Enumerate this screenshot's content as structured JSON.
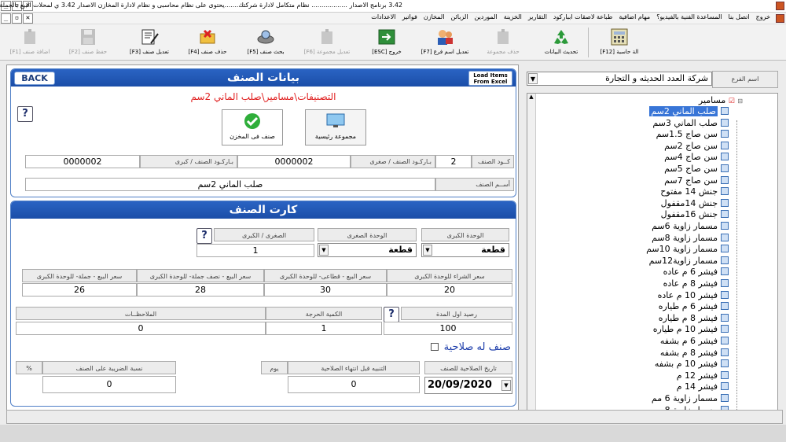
{
  "window": {
    "title": "3.42 برنامج الاصدار .................. نظام متكامل لادارة شركتك.......يحتوى على نظام محاسبى و نظام لادارة المخازن الاصدار 3.42 ي لمحلات البيع بالجملة و التجارة"
  },
  "menu": [
    "الاعدادات",
    "فواتير",
    "المخازن",
    "الزبائن",
    "الموردين",
    "الخزينة",
    "التقارير",
    "طباعة لاصقات ابباركود",
    "مهام اضافية",
    "المساعدة الفنية بالفيديو؟",
    "اتصل بنا",
    "خروج"
  ],
  "toolbar": {
    "calc": "الة حاسبة [F12]",
    "refresh": "تحديث البيانات",
    "delete_group": "حذف مجموعة",
    "rename_branch": "تعديل اسم فرع [F7]",
    "exit": "خروج [ESC]",
    "edit_group": "تعديل مجموعة [F6]",
    "search_item": "بحث صنف [F5]",
    "delete_item": "حذف صنف [F4]",
    "edit_item": "تعديل صنف [F3]",
    "save_item": "حفظ صنف [F2]",
    "add_item": "اضافة صنف [F1]"
  },
  "item_panel": {
    "title": "بيانات الصنف",
    "back": "BACK",
    "load_excel_l1": "Load Items",
    "load_excel_l2": "From Excel",
    "path": "التصنيفات\\مسامير\\صلب الماني 2سم",
    "help": "?",
    "main_group": "مجموعة رئيسية",
    "stock_item": "صنف فى المخزن",
    "code_label": "كــود الصنف",
    "code_value": "2",
    "barcode_small_label": "بـاركـود الصنف / صغرى",
    "barcode_small_value": "0000002",
    "barcode_big_label": "بـاركـود الصنف / كبرى",
    "barcode_big_value": "0000002",
    "name_label": "أســم الصنف",
    "name_value": "صلب الماني 2سم"
  },
  "card_panel": {
    "title": "كارت الصنف",
    "big_unit_label": "الوحدة الكبرى",
    "big_unit_value": "قطعة",
    "small_unit_label": "الوحدة الصغرى",
    "small_unit_value": "قطعة",
    "ratio_label": "الصغرى / الكبرى",
    "ratio_value": "1",
    "help": "?",
    "price_cols": [
      "سعر الشراء للوحدة الكبرى",
      "سعر البيع - قطاعى- للوحدة الكبرى",
      "سعر البيع - نصف جملة- للوحدة الكبرى",
      "سعر البيع - جملة- للوحدة الكبرى"
    ],
    "price_vals": [
      "20",
      "30",
      "28",
      "26"
    ],
    "opening_label": "رصيد اول المدة",
    "opening_value": "100",
    "critical_label": "الكمية الحرجة",
    "critical_value": "1",
    "notes_label": "الملاحظــات",
    "notes_value": "0",
    "expiry_checkbox": "صنف له صلاحية",
    "expiry_date_label": "تاريخ الصلاحية للصنف",
    "expiry_date_value": "20/09/2020",
    "alert_label": "التنبيه قبل انتهاء الصلاحية",
    "alert_value": "0",
    "alert_unit": "يوم",
    "tax_label": "نسبة الضريبة على الصنف",
    "tax_value": "0",
    "tax_unit": "%"
  },
  "branch": {
    "label": "اسم الفرع",
    "value": "شركة العدد الحديثه و التجارة"
  },
  "tree": {
    "root": "مسامير",
    "items": [
      "صلب الماني 2سم",
      "صلب الماني 3سم",
      "سن صاج 1.5سم",
      "سن صاج 2سم",
      "سن صاج 4سم",
      "سن صاج 5سم",
      "سن صاج 7سم",
      "جنش 14 مفتوح",
      "جنش 14مقفول",
      "جنش 16مقفول",
      "مسمار زاوية 6سم",
      "مسمار زاوية 8سم",
      "مسمار زاوية 10سم",
      "مسمار زاوية12سم",
      "فيشر 6 م عاده",
      "فيشر 8 م عاده",
      "فيشر 10 م عاده",
      "فيشر 6 م طياره",
      "فيشر 8 م طياره",
      "فيشر 10 م طياره",
      "فيشر 6 م بشفه",
      "فيشر 8 م بشفه",
      "فيشر 10 م بشفه",
      "فيشر 12 م",
      "فيشر 14 م",
      "مسمار زاوية 6 مم",
      "مسمار زاوية 8 مم"
    ]
  }
}
